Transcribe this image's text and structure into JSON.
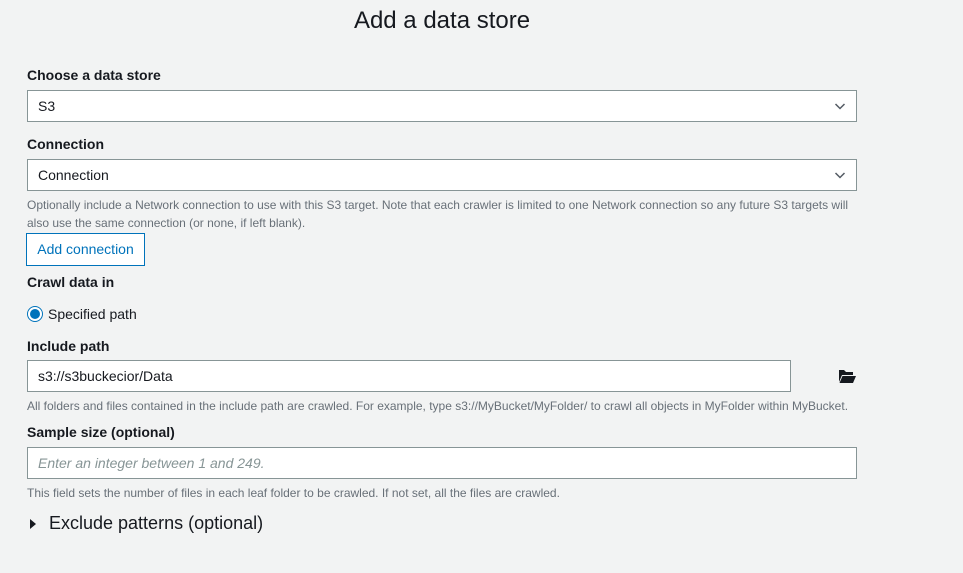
{
  "page": {
    "title": "Add a data store"
  },
  "data_store": {
    "label": "Choose a data store",
    "selected": "S3"
  },
  "connection": {
    "label": "Connection",
    "selected": "Connection",
    "hint": "Optionally include a Network connection to use with this S3 target. Note that each crawler is limited to one Network connection so any future S3 targets will also use the same connection (or none, if left blank).",
    "add_button": "Add connection"
  },
  "crawl": {
    "label": "Crawl data in",
    "option": "Specified path",
    "checked": true
  },
  "include_path": {
    "label": "Include path",
    "value": "s3://s3buckecior/Data",
    "hint": "All folders and files contained in the include path are crawled. For example, type s3://MyBucket/MyFolder/ to crawl all objects in MyFolder within MyBucket.",
    "browse_icon": "folder-open-icon"
  },
  "sample_size": {
    "label": "Sample size (optional)",
    "placeholder": "Enter an integer between 1 and 249.",
    "value": "",
    "hint": "This field sets the number of files in each leaf folder to be crawled. If not set, all the files are crawled."
  },
  "exclude": {
    "label": "Exclude patterns (optional)",
    "icon": "caret-right-icon"
  },
  "colors": {
    "accent": "#0073bb",
    "background": "#f2f3f3",
    "border": "#879596",
    "hint_text": "#687078"
  }
}
